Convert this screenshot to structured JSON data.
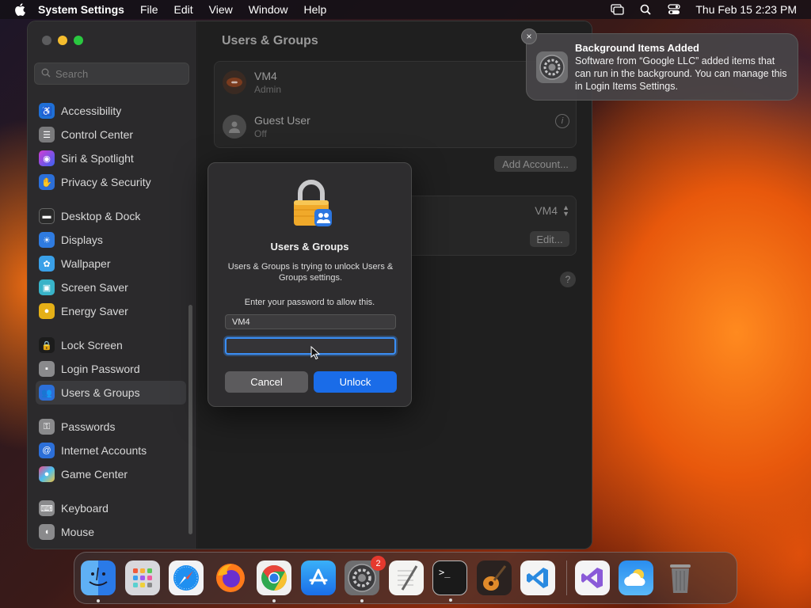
{
  "menubar": {
    "app_name": "System Settings",
    "items": [
      "File",
      "Edit",
      "View",
      "Window",
      "Help"
    ],
    "clock": "Thu Feb 15  2:23 PM"
  },
  "sidebar": {
    "search_placeholder": "Search",
    "groups": [
      [
        "Accessibility",
        "Control Center",
        "Siri & Spotlight",
        "Privacy & Security"
      ],
      [
        "Desktop & Dock",
        "Displays",
        "Wallpaper",
        "Screen Saver",
        "Energy Saver"
      ],
      [
        "Lock Screen",
        "Login Password",
        "Users & Groups"
      ],
      [
        "Passwords",
        "Internet Accounts",
        "Game Center"
      ],
      [
        "Keyboard",
        "Mouse"
      ]
    ],
    "selected": "Users & Groups"
  },
  "main": {
    "title": "Users & Groups",
    "users": [
      {
        "name": "VM4",
        "role": "Admin"
      },
      {
        "name": "Guest User",
        "role": "Off"
      }
    ],
    "add_account_label": "Add Account...",
    "autologin_value": "VM4",
    "edit_label": "Edit...",
    "help_label": "?"
  },
  "dialog": {
    "title": "Users & Groups",
    "message": "Users & Groups is trying to unlock Users & Groups settings.",
    "prompt": "Enter your password to allow this.",
    "username_value": "VM4",
    "password_value": "",
    "cancel_label": "Cancel",
    "unlock_label": "Unlock"
  },
  "notification": {
    "title": "Background Items Added",
    "body": "Software from “Google LLC” added items that can run in the background. You can manage this in Login Items Settings.",
    "close_label": "×"
  },
  "dock": {
    "settings_badge": "2",
    "apps": [
      "finder-icon",
      "launchpad-icon",
      "safari-icon",
      "firefox-icon",
      "chrome-icon",
      "app-store-icon",
      "system-settings-icon",
      "textedit-icon",
      "terminal-icon",
      "garageband-icon",
      "vscode-icon",
      "visual-studio-icon",
      "weather-icon",
      "trash-icon"
    ]
  },
  "colors": {
    "accent": "#1a6ce8",
    "traffic_red": "#5a5a5a",
    "badge": "#e5392e"
  }
}
